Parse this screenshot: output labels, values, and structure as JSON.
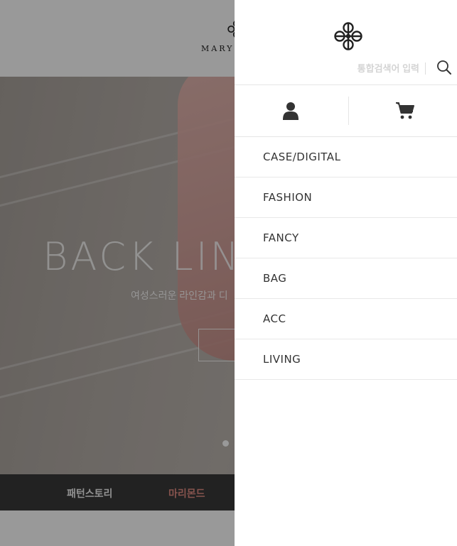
{
  "page": {
    "logo_text": "MARY",
    "hero": {
      "title": "BACK LIN",
      "subtitle": "여성스러운 라인감과 디",
      "slide_indicator": "dot"
    },
    "bottom_nav": [
      {
        "label": "패턴스토리",
        "color": "#f0f0f0"
      },
      {
        "label": "마리몬드",
        "color": "#e08a80"
      }
    ]
  },
  "drawer": {
    "logo_icon": "clover-ornament-icon",
    "search": {
      "placeholder": "통합검색어 입력",
      "icon": "search-icon"
    },
    "actions": [
      {
        "icon": "user-icon"
      },
      {
        "icon": "cart-icon"
      }
    ],
    "categories": [
      {
        "label": "CASE/DIGITAL"
      },
      {
        "label": "FASHION"
      },
      {
        "label": "FANCY"
      },
      {
        "label": "BAG"
      },
      {
        "label": "ACC"
      },
      {
        "label": "LIVING"
      }
    ]
  },
  "colors": {
    "overlay": "rgba(0,0,0,0.4)",
    "bottom_bar": "#3a3a3a",
    "accent": "#e08a80",
    "icon": "#333333"
  }
}
